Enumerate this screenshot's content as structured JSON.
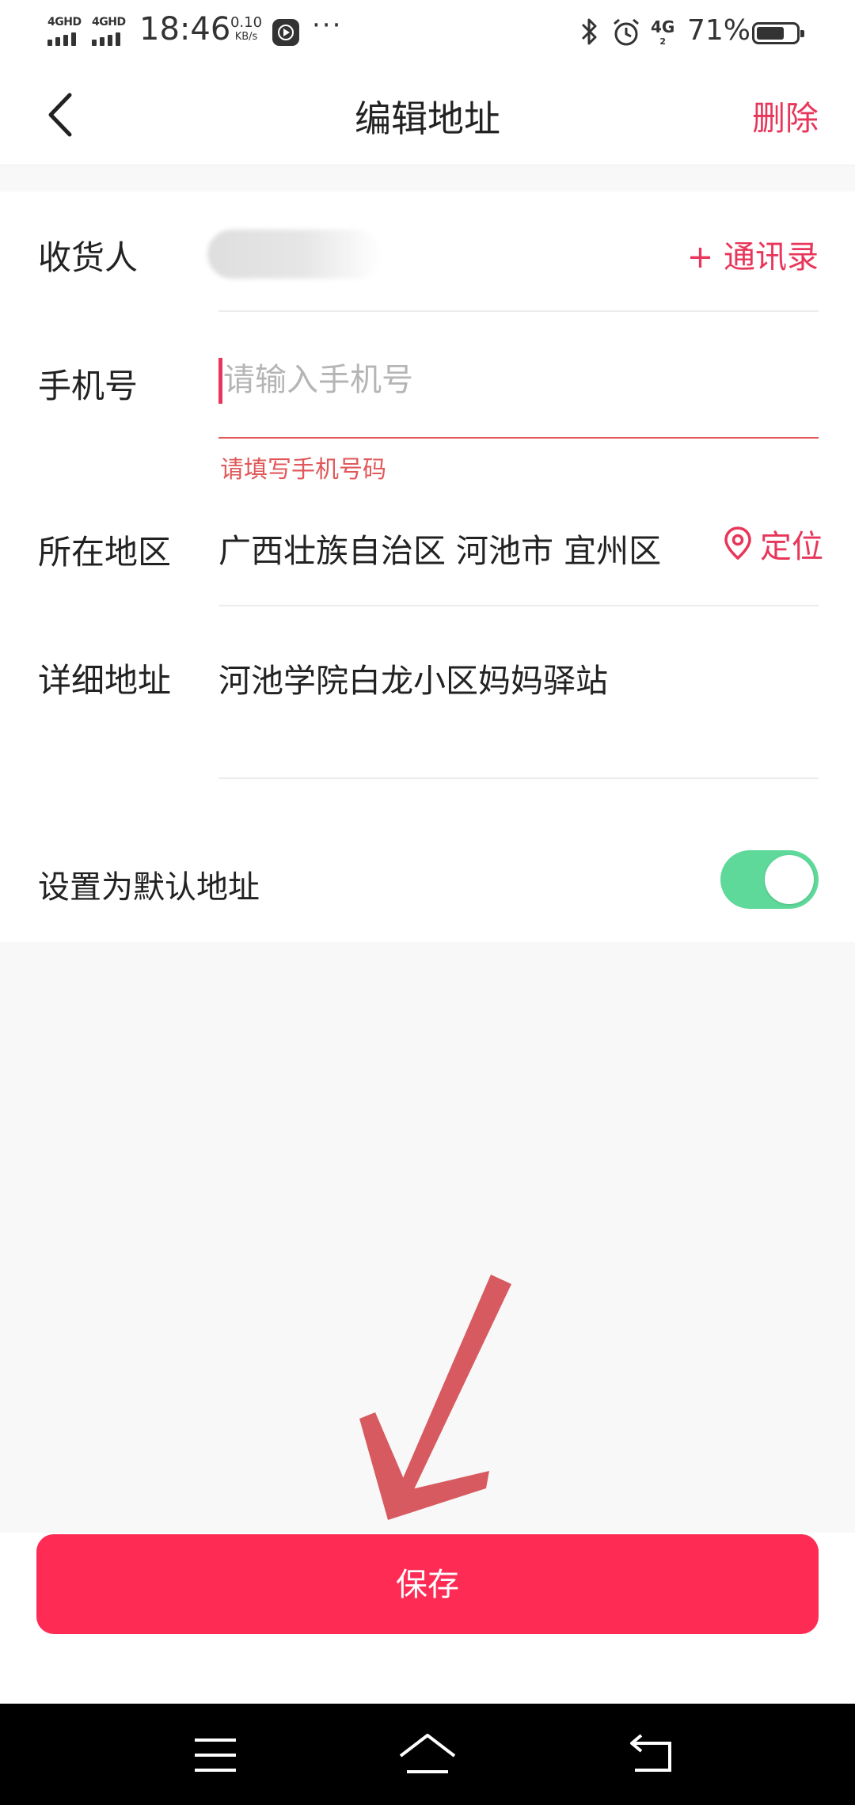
{
  "status_bar": {
    "network_1": "4GHD",
    "network_2": "4GHD",
    "time": "18:46",
    "speed_value": "0.10",
    "speed_unit": "KB/s",
    "more": "···",
    "network_3": "4G",
    "network_3_sub": "2",
    "battery_percent": "71%",
    "battery_level": 0.71
  },
  "nav": {
    "title": "编辑地址",
    "delete_label": "删除"
  },
  "form": {
    "recipient": {
      "label": "收货人",
      "contacts_label": "+ 通讯录"
    },
    "phone": {
      "label": "手机号",
      "value": "",
      "placeholder": "请输入手机号",
      "error": "请填写手机号码"
    },
    "region": {
      "label": "所在地区",
      "value": "广西壮族自治区 河池市 宜州区",
      "locate_label": "定位"
    },
    "detail": {
      "label": "详细地址",
      "value": "河池学院白龙小区妈妈驿站"
    },
    "default_address": {
      "label": "设置为默认地址",
      "enabled": true
    }
  },
  "save_label": "保存",
  "colors": {
    "accent": "#fe2c55",
    "accent_text": "#e8365a",
    "error": "#e0585a",
    "toggle_on": "#5ed99a"
  },
  "icons": {
    "back": "chevron-left-icon",
    "locate": "location-pin-icon",
    "menu": "menu-icon",
    "home": "home-icon",
    "back_system": "back-icon"
  }
}
